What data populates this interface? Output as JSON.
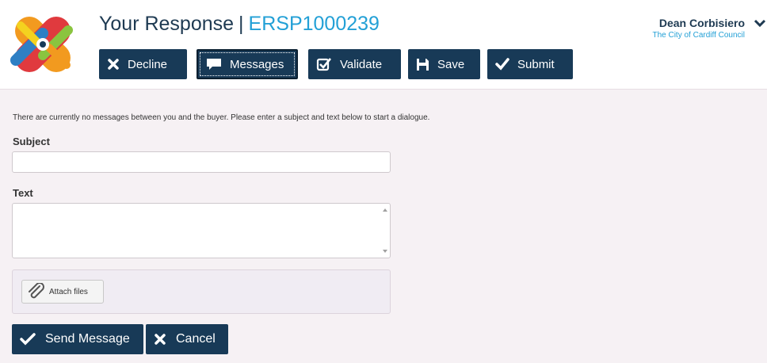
{
  "header": {
    "title": "Your Response",
    "separator": "|",
    "reference": "ERSP1000239",
    "user_name": "Dean Corbisiero",
    "organisation": "The City of Cardiff Council"
  },
  "toolbar": {
    "decline_label": "Decline",
    "messages_label": "Messages",
    "validate_label": "Validate",
    "save_label": "Save",
    "submit_label": "Submit"
  },
  "messages": {
    "info_text": "There are currently no messages between you and the buyer. Please enter a subject and text below to start a dialogue.",
    "subject_label": "Subject",
    "subject_value": "",
    "text_label": "Text",
    "text_value": "",
    "attach_label": "Attach files",
    "send_label": "Send Message",
    "cancel_label": "Cancel"
  },
  "colors": {
    "brand_dark": "#183a57",
    "accent_blue": "#23a0d6",
    "panel_background": "#f6f1f4"
  }
}
